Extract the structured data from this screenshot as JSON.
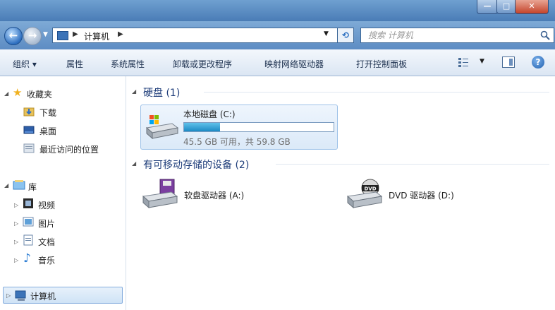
{
  "address": {
    "crumb": "计算机",
    "search_placeholder": "搜索 计算机"
  },
  "toolbar": {
    "items": [
      "组织 ▾",
      "属性",
      "系统属性",
      "卸载或更改程序",
      "映射网络驱动器",
      "打开控制面板"
    ]
  },
  "navpane": {
    "favorites": "收藏夹",
    "fav_items": [
      "下载",
      "桌面",
      "最近访问的位置"
    ],
    "libraries": "库",
    "lib_items": [
      "视频",
      "图片",
      "文档",
      "音乐"
    ],
    "computer": "计算机"
  },
  "content": {
    "group_hdd": "硬盘 (1)",
    "drive_c": {
      "name": "本地磁盘 (C:)",
      "usage_text": "45.5 GB 可用，共 59.8 GB",
      "used_fraction": 0.24
    },
    "group_removable": "有可移动存储的设备 (2)",
    "drive_a": "软盘驱动器 (A:)",
    "drive_d": "DVD 驱动器 (D:)",
    "dvd_badge": "DVD"
  },
  "colors": {
    "accent": "#5d8cc3",
    "bar_fill": "#1c8ac4",
    "group_header": "#1e3d7a"
  }
}
